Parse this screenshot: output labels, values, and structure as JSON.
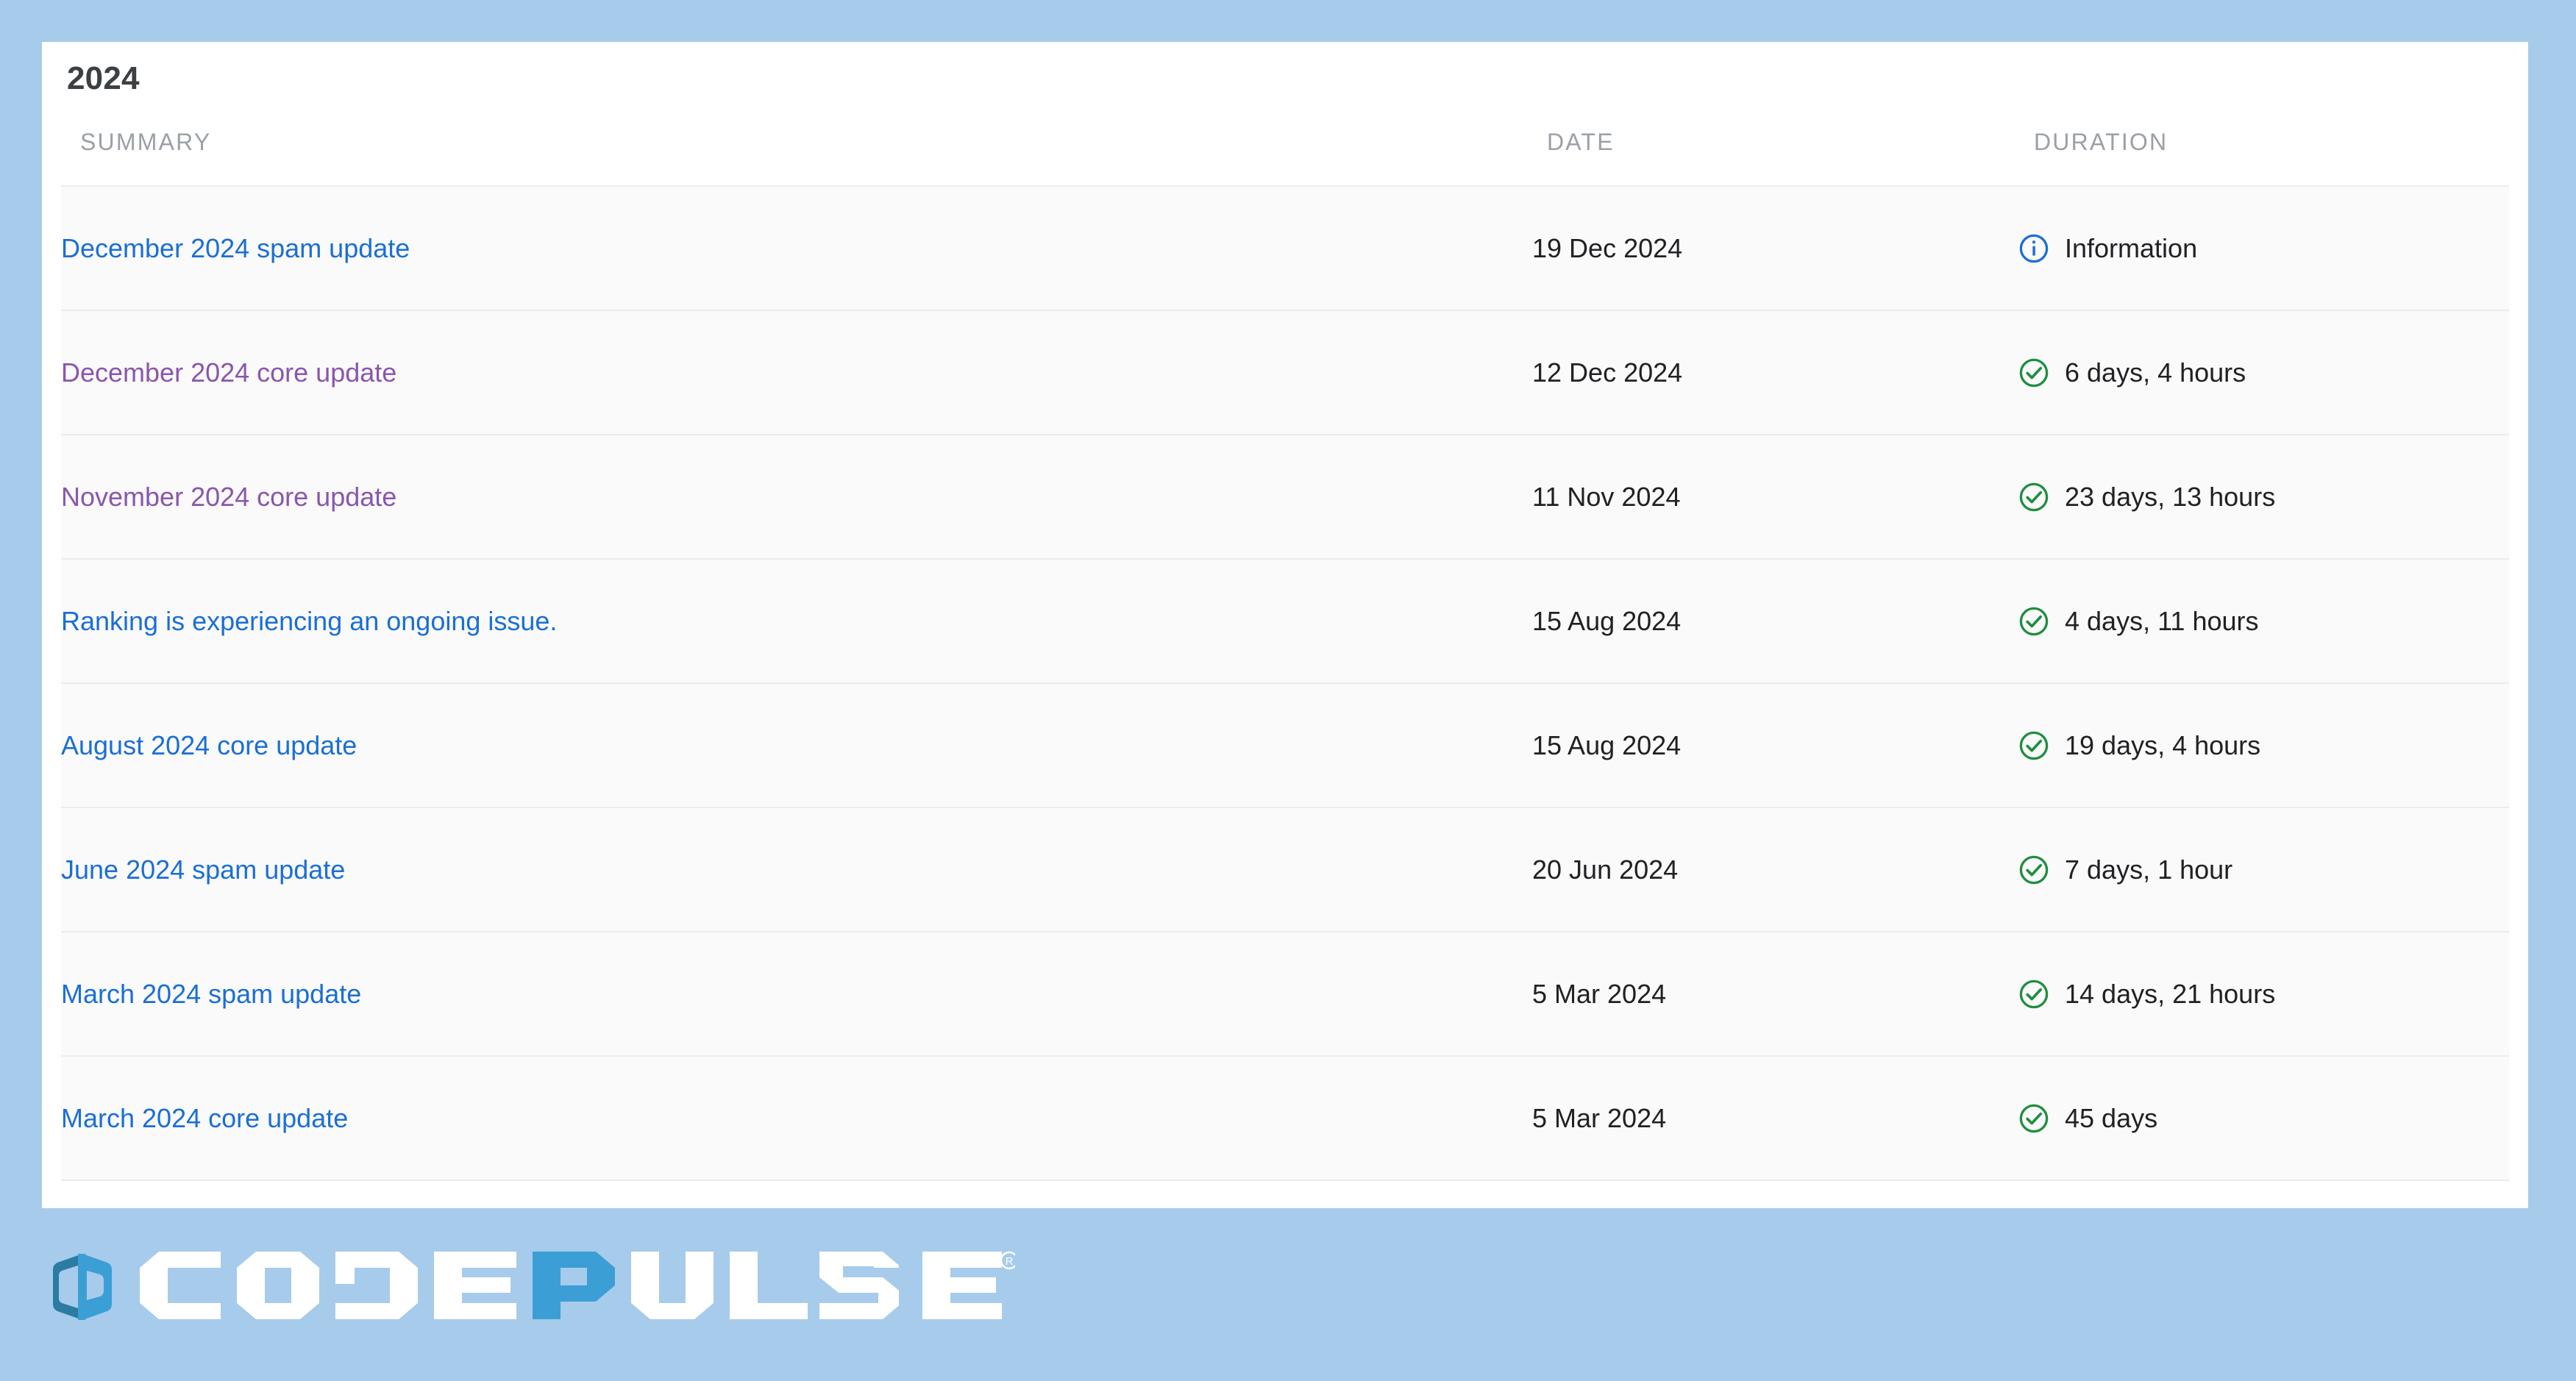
{
  "card": {
    "year_title": "2024",
    "columns": {
      "summary": "SUMMARY",
      "date": "DATE",
      "duration": "DURATION"
    },
    "rows": [
      {
        "summary": "December 2024 spam update",
        "date": "19 Dec 2024",
        "duration": "Information",
        "status_icon": "info-circle-icon",
        "link_state": "unvisited"
      },
      {
        "summary": "December 2024 core update",
        "date": "12 Dec 2024",
        "duration": "6 days, 4 hours",
        "status_icon": "check-circle-icon",
        "link_state": "visited"
      },
      {
        "summary": "November 2024 core update",
        "date": "11 Nov 2024",
        "duration": "23 days, 13 hours",
        "status_icon": "check-circle-icon",
        "link_state": "visited"
      },
      {
        "summary": "Ranking is experiencing an ongoing issue.",
        "date": "15 Aug 2024",
        "duration": "4 days, 11 hours",
        "status_icon": "check-circle-icon",
        "link_state": "unvisited"
      },
      {
        "summary": "August 2024 core update",
        "date": "15 Aug 2024",
        "duration": "19 days, 4 hours",
        "status_icon": "check-circle-icon",
        "link_state": "unvisited"
      },
      {
        "summary": "June 2024 spam update",
        "date": "20 Jun 2024",
        "duration": "7 days, 1 hour",
        "status_icon": "check-circle-icon",
        "link_state": "unvisited"
      },
      {
        "summary": "March 2024 spam update",
        "date": "5 Mar 2024",
        "duration": "14 days, 21 hours",
        "status_icon": "check-circle-icon",
        "link_state": "unvisited"
      },
      {
        "summary": "March 2024 core update",
        "date": "5 Mar 2024",
        "duration": "45 days",
        "status_icon": "check-circle-icon",
        "link_state": "unvisited"
      }
    ]
  },
  "logo": {
    "mark_icon": "codepulse-hexagon-mark-icon",
    "text_part_1": "CODE",
    "text_part_2": "P",
    "text_part_3": "ULSE",
    "registered_mark": "®"
  },
  "colors": {
    "page_background": "#a7cbeb",
    "card_background": "#ffffff",
    "row_background": "#fafafa",
    "row_divider": "#ececec",
    "link": "#1a6fd4",
    "link_visited": "#8a56ac",
    "header_text": "#9aa0a6",
    "body_text": "#202124",
    "info_icon": "#1a6fd4",
    "success_icon": "#1e8e3e",
    "logo_mark_dark": "#2b7ba3",
    "logo_mark_light": "#3b9fd6",
    "logo_text_white": "#ffffff",
    "logo_text_blue": "#3b9fd6"
  }
}
